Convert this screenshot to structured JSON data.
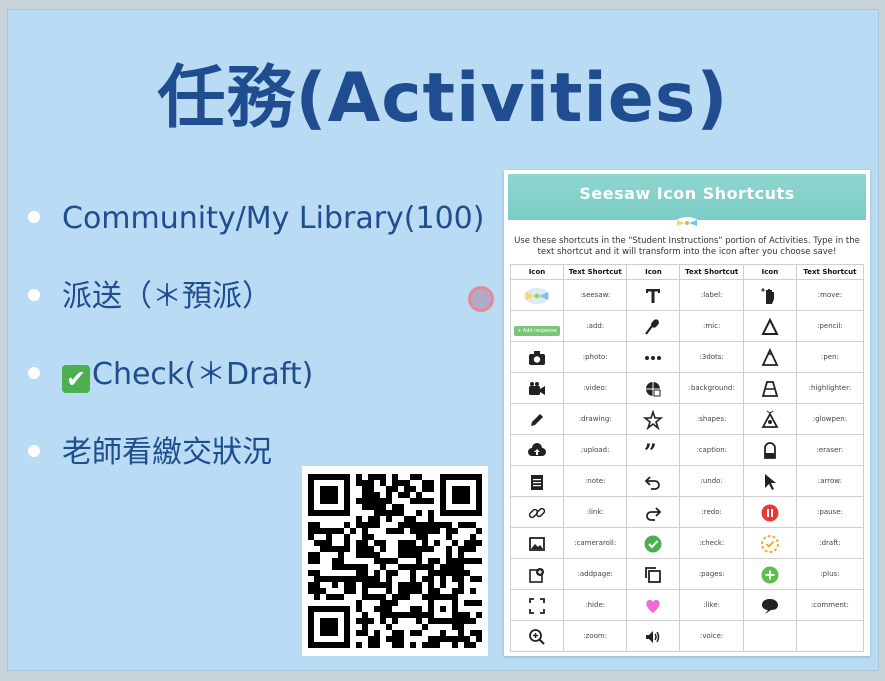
{
  "slide": {
    "title": "任務(Activities)",
    "bullets": [
      {
        "text": "Community/My Library(100)"
      },
      {
        "text": "派送（＊預派）"
      },
      {
        "emoji": "✔",
        "text": "Check(＊Draft)"
      },
      {
        "text": "老師看繳交狀況"
      }
    ]
  },
  "card": {
    "title": "Seesaw Icon Shortcuts",
    "intro": "Use these shortcuts in the \"Student Instructions\" portion of Activities. Type in the text shortcut and it will transform into the icon after you choose save!",
    "headers": [
      "Icon",
      "Text Shortcut",
      "Icon",
      "Text Shortcut",
      "Icon",
      "Text Shortcut"
    ],
    "add_response_label": "+ Add response",
    "rows": [
      [
        {
          "icon": "seesaw-logo-icon",
          "code": ":seesaw:"
        },
        {
          "icon": "text-t-icon",
          "code": ":label:"
        },
        {
          "icon": "move-hand-icon",
          "code": ":move:"
        }
      ],
      [
        {
          "icon": "add-response-icon",
          "code": ":add:"
        },
        {
          "icon": "microphone-icon",
          "code": ":mic:"
        },
        {
          "icon": "pencil-tool-icon",
          "code": ":pencil:"
        }
      ],
      [
        {
          "icon": "camera-icon",
          "code": ":photo:"
        },
        {
          "icon": "three-dots-icon",
          "code": ":3dots:"
        },
        {
          "icon": "pen-tool-icon",
          "code": ":pen:"
        }
      ],
      [
        {
          "icon": "video-camera-icon",
          "code": ":video:"
        },
        {
          "icon": "background-icon",
          "code": ":background:"
        },
        {
          "icon": "highlighter-icon",
          "code": ":highlighter:"
        }
      ],
      [
        {
          "icon": "drawing-pencil-icon",
          "code": ":drawing:"
        },
        {
          "icon": "shapes-icon",
          "code": ":shapes:"
        },
        {
          "icon": "glowpen-icon",
          "code": ":glowpen:"
        }
      ],
      [
        {
          "icon": "upload-cloud-icon",
          "code": ":upload:"
        },
        {
          "icon": "caption-quote-icon",
          "code": ":caption:"
        },
        {
          "icon": "eraser-icon",
          "code": ":eraser:"
        }
      ],
      [
        {
          "icon": "note-icon",
          "code": ":note:"
        },
        {
          "icon": "undo-icon",
          "code": ":undo:"
        },
        {
          "icon": "arrow-cursor-icon",
          "code": ":arrow:"
        }
      ],
      [
        {
          "icon": "link-icon",
          "code": ":link:"
        },
        {
          "icon": "redo-icon",
          "code": ":redo:"
        },
        {
          "icon": "pause-icon",
          "code": ":pause:"
        }
      ],
      [
        {
          "icon": "camera-roll-icon",
          "code": ":cameraroll:"
        },
        {
          "icon": "check-icon",
          "code": ":check:"
        },
        {
          "icon": "draft-icon",
          "code": ":draft:"
        }
      ],
      [
        {
          "icon": "add-page-icon",
          "code": ":addpage:"
        },
        {
          "icon": "pages-icon",
          "code": ":pages:"
        },
        {
          "icon": "plus-icon",
          "code": ":plus:"
        }
      ],
      [
        {
          "icon": "hide-icon",
          "code": ":hide:"
        },
        {
          "icon": "heart-icon",
          "code": ":like:"
        },
        {
          "icon": "comment-icon",
          "code": ":comment:"
        }
      ],
      [
        {
          "icon": "zoom-icon",
          "code": ":zoom:"
        },
        {
          "icon": "speaker-icon",
          "code": ":voice:"
        },
        {
          "icon": "",
          "code": ""
        }
      ]
    ]
  },
  "colors": {
    "slide_bg": "#b9dcf4",
    "title": "#1f4d8f",
    "header_teal": "#7cccc5",
    "check_green": "#4caf50",
    "pause_red": "#e53935",
    "heart_pink": "#f06bd6",
    "draft_orange": "#f5a623"
  }
}
